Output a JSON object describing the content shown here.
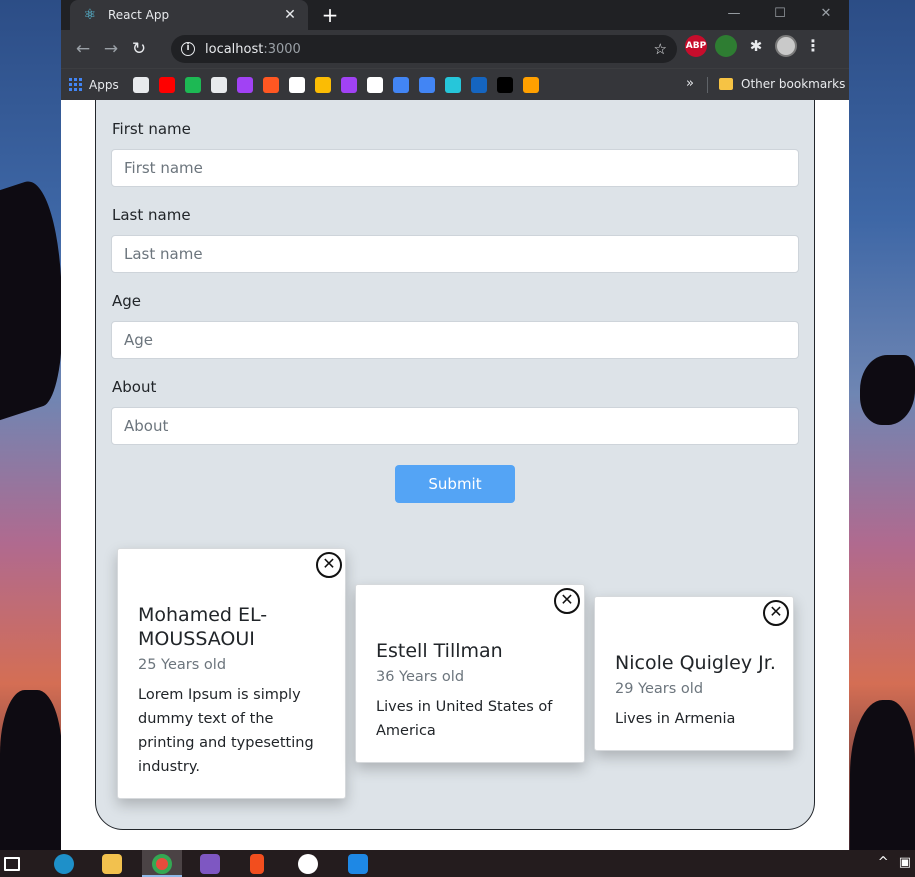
{
  "browser": {
    "tab_title": "React App",
    "tab_close": "✕",
    "new_tab": "+",
    "window_controls": [
      "—",
      "☐",
      "✕"
    ],
    "url_host": "localhost",
    "url_port": ":3000",
    "bookmarks": {
      "apps_label": "Apps",
      "more_label": "»",
      "other_label": "Other bookmarks",
      "icon_colors": [
        "#e8eaed",
        "#ff0000",
        "#1db954",
        "#e8eaed",
        "#a142f4",
        "#ff5722",
        "#ffffff",
        "#fbbc04",
        "#a142f4",
        "#ffffff",
        "#4285f4",
        "#4285f4",
        "#26c6da",
        "#1565c0",
        "#000000",
        "#ffa000"
      ]
    },
    "extensions": {
      "abp_label": "ABP"
    }
  },
  "form": {
    "first_name_label": "First name",
    "first_name_placeholder": "First name",
    "last_name_label": "Last name",
    "last_name_placeholder": "Last name",
    "age_label": "Age",
    "age_placeholder": "Age",
    "about_label": "About",
    "about_placeholder": "About",
    "submit_label": "Submit"
  },
  "cards": [
    {
      "name_line1": "Mohamed EL-",
      "name_line2": "MOUSSAOUI",
      "age": "25 Years old",
      "about_lines": [
        "Lorem Ipsum is simply",
        "dummy text of the",
        "printing and typesetting",
        "industry."
      ]
    },
    {
      "name_line1": "Estell Tillman",
      "age": "36 Years old",
      "about_lines": [
        "Lives in United States of",
        "America"
      ]
    },
    {
      "name_line1": "Nicole Quigley Jr.",
      "age": "29 Years old",
      "about_lines": [
        "Lives in Armenia"
      ]
    }
  ],
  "colors": {
    "accent": "#54a4f5",
    "app_background": "#dde3e8",
    "chrome_dark": "#35363a"
  },
  "card_close_symbol": "✕",
  "taskbar": {
    "tray_up": "^"
  }
}
